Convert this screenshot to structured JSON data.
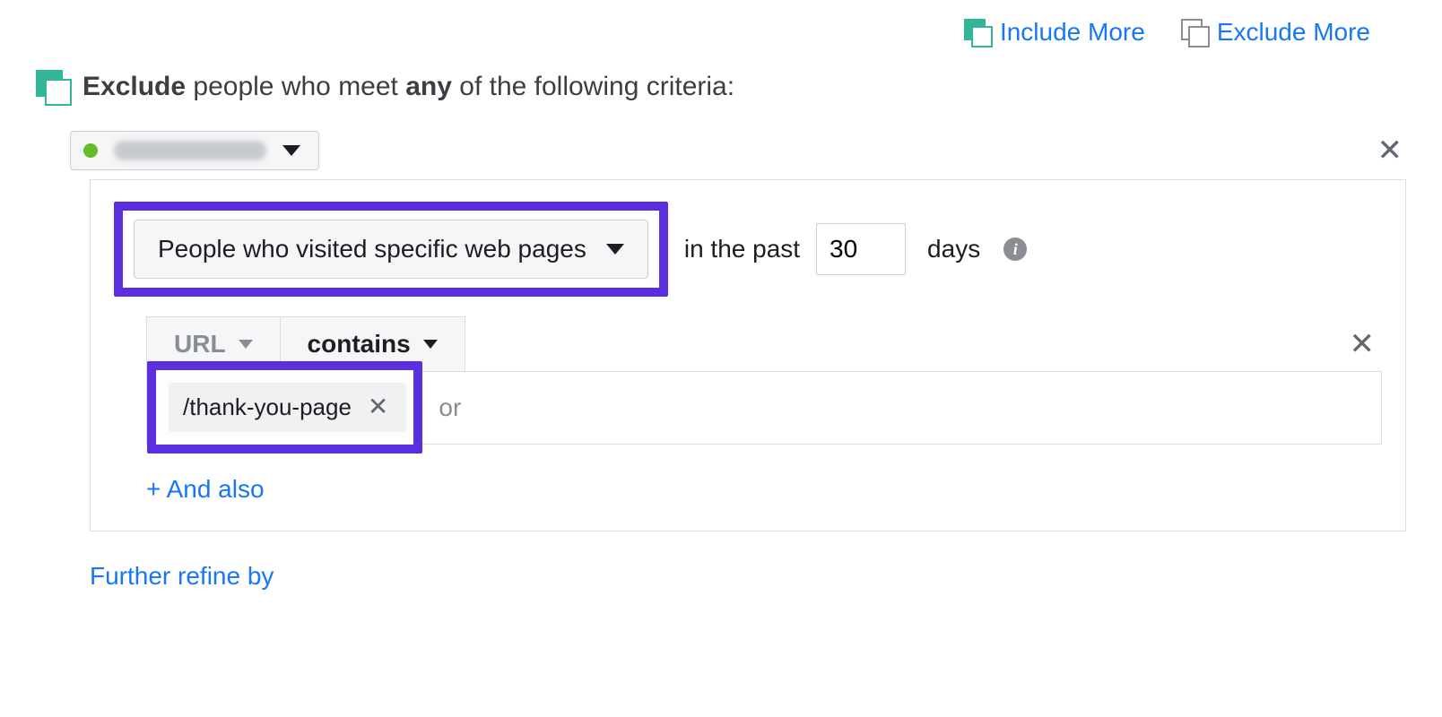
{
  "top_links": {
    "include_more": "Include More",
    "exclude_more": "Exclude More"
  },
  "heading": {
    "exclude_bold": "Exclude",
    "mid": " people who meet ",
    "any_bold": "any",
    "tail": " of the following criteria:"
  },
  "source": {
    "status": "active",
    "name_placeholder": "Pixel source"
  },
  "rule": {
    "event_type": "People who visited specific web pages",
    "in_past_label": "in the past",
    "days_value": "30",
    "days_label": "days"
  },
  "url_filter": {
    "field": "URL",
    "operator": "contains",
    "values": [
      "/thank-you-page"
    ],
    "input_placeholder": "or"
  },
  "and_also": "+ And also",
  "refine_by": "Further refine by"
}
